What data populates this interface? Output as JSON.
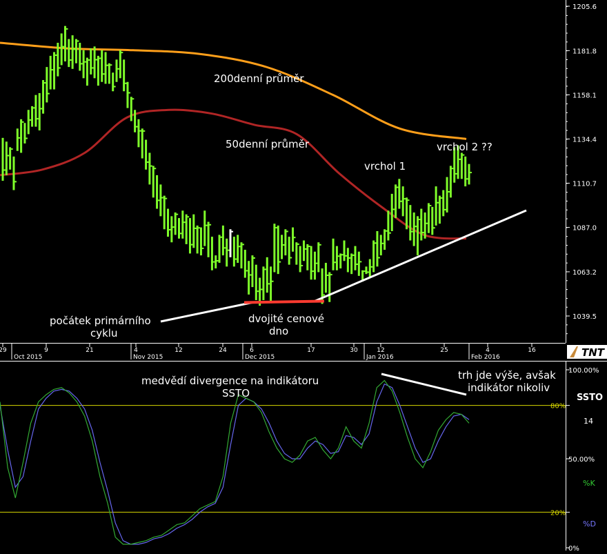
{
  "chart_data": [
    {
      "type": "ohlc",
      "price_axis": {
        "ticks": [
          "1205.6",
          "1181.8",
          "1158.1",
          "1134.4",
          "1110.7",
          "1087.0",
          "1063.2",
          "1039.5"
        ],
        "ylim": [
          1025,
          1212
        ]
      },
      "date_axis": {
        "ticks": [
          "29",
          "9",
          "21",
          "4",
          "12",
          "24",
          "6",
          "17",
          "30",
          "12",
          "25",
          "4",
          "16"
        ],
        "months": [
          "Oct 2015",
          "Nov 2015",
          "Dec 2015",
          "Jan 2016",
          "Feb 2016"
        ]
      },
      "logo": "TNT",
      "bars": [
        [
          1135,
          1112
        ],
        [
          1133,
          1115
        ],
        [
          1130,
          1118
        ],
        [
          1125,
          1107
        ],
        [
          1140,
          1128
        ],
        [
          1145,
          1127
        ],
        [
          1143,
          1132
        ],
        [
          1150,
          1137
        ],
        [
          1152,
          1141
        ],
        [
          1158,
          1141
        ],
        [
          1159,
          1139
        ],
        [
          1166,
          1148
        ],
        [
          1173,
          1154
        ],
        [
          1179,
          1161
        ],
        [
          1181,
          1161
        ],
        [
          1186,
          1168
        ],
        [
          1191,
          1174
        ],
        [
          1195,
          1176
        ],
        [
          1188,
          1173
        ],
        [
          1190,
          1172
        ],
        [
          1188,
          1175
        ],
        [
          1186,
          1171
        ],
        [
          1182,
          1167
        ],
        [
          1178,
          1163
        ],
        [
          1183,
          1169
        ],
        [
          1184,
          1167
        ],
        [
          1179,
          1163
        ],
        [
          1182,
          1165
        ],
        [
          1181,
          1164
        ],
        [
          1175,
          1164
        ],
        [
          1170,
          1160
        ],
        [
          1177,
          1165
        ],
        [
          1182,
          1167
        ],
        [
          1177,
          1160
        ],
        [
          1165,
          1151
        ],
        [
          1157,
          1144
        ],
        [
          1150,
          1138
        ],
        [
          1145,
          1130
        ],
        [
          1140,
          1124
        ],
        [
          1134,
          1118
        ],
        [
          1127,
          1110
        ],
        [
          1120,
          1103
        ],
        [
          1115,
          1097
        ],
        [
          1110,
          1093
        ],
        [
          1104,
          1086
        ],
        [
          1097,
          1082
        ],
        [
          1093,
          1079
        ],
        [
          1095,
          1083
        ],
        [
          1092,
          1081
        ],
        [
          1096,
          1081
        ],
        [
          1094,
          1078
        ],
        [
          1092,
          1073
        ],
        [
          1094,
          1076
        ],
        [
          1088,
          1073
        ],
        [
          1087,
          1072
        ],
        [
          1096,
          1077
        ],
        [
          1090,
          1071
        ],
        [
          1082,
          1064
        ],
        [
          1072,
          1065
        ],
        [
          1083,
          1068
        ],
        [
          1088,
          1072
        ],
        [
          1081,
          1066
        ],
        [
          1086,
          1071
        ],
        [
          1082,
          1066
        ],
        [
          1083,
          1068
        ],
        [
          1079,
          1065
        ],
        [
          1075,
          1060
        ],
        [
          1069,
          1051
        ],
        [
          1072,
          1055
        ],
        [
          1067,
          1048
        ],
        [
          1060,
          1045
        ],
        [
          1066,
          1048
        ],
        [
          1071,
          1052
        ],
        [
          1066,
          1047
        ],
        [
          1089,
          1063
        ],
        [
          1088,
          1062
        ],
        [
          1083,
          1070
        ],
        [
          1086,
          1072
        ],
        [
          1082,
          1067
        ],
        [
          1087,
          1074
        ],
        [
          1079,
          1067
        ],
        [
          1077,
          1063
        ],
        [
          1080,
          1069
        ],
        [
          1078,
          1064
        ],
        [
          1077,
          1059
        ],
        [
          1074,
          1059
        ],
        [
          1079,
          1063
        ],
        [
          1065,
          1046
        ],
        [
          1068,
          1052
        ],
        [
          1063,
          1047
        ],
        [
          1081,
          1064
        ],
        [
          1077,
          1064
        ],
        [
          1073,
          1065
        ],
        [
          1080,
          1069
        ],
        [
          1076,
          1063
        ],
        [
          1073,
          1062
        ],
        [
          1077,
          1064
        ],
        [
          1074,
          1061
        ],
        [
          1064,
          1058
        ],
        [
          1066,
          1062
        ],
        [
          1070,
          1060
        ],
        [
          1080,
          1063
        ],
        [
          1085,
          1066
        ],
        [
          1083,
          1072
        ],
        [
          1086,
          1075
        ],
        [
          1096,
          1080
        ],
        [
          1105,
          1085
        ],
        [
          1110,
          1092
        ],
        [
          1113,
          1097
        ],
        [
          1109,
          1093
        ],
        [
          1103,
          1086
        ],
        [
          1099,
          1080
        ],
        [
          1095,
          1077
        ],
        [
          1093,
          1072
        ],
        [
          1097,
          1080
        ],
        [
          1095,
          1081
        ],
        [
          1100,
          1084
        ],
        [
          1098,
          1083
        ],
        [
          1109,
          1088
        ],
        [
          1104,
          1089
        ],
        [
          1107,
          1093
        ],
        [
          1114,
          1095
        ],
        [
          1120,
          1103
        ],
        [
          1130,
          1111
        ],
        [
          1131,
          1113
        ],
        [
          1127,
          1113
        ],
        [
          1125,
          1109
        ],
        [
          1121,
          1110
        ]
      ],
      "ma200": [
        1186,
        1183,
        1182,
        1180,
        1173,
        1158,
        1140,
        1134.4
      ],
      "ma50": [
        1115,
        1118,
        1127,
        1146,
        1150,
        1148,
        1142,
        1137,
        1116,
        1098,
        1083,
        1081
      ],
      "annotations": {
        "ma200_label": "200denní průměr",
        "ma50_label": "50denní průměr",
        "peak1": "vrchol 1",
        "peak2": "vrchol 2 ??",
        "start_line1": "počátek primárního",
        "start_line2": "cyklu",
        "double_bottom_line1": "dvojité cenové",
        "double_bottom_line2": "dno"
      }
    },
    {
      "type": "line",
      "name": "SSTO",
      "ylim": [
        0,
        100
      ],
      "levels": [
        80,
        20
      ],
      "ticks": [
        "100.00%",
        "80%",
        "50.00%",
        "20%",
        "0%"
      ],
      "side_labels": {
        "title": "SSTO",
        "period": "14",
        "k": "%K",
        "d": "%D"
      },
      "annotations": {
        "divergence_line1": "medvědí divergence na indikátoru",
        "divergence_line2": "SSTO",
        "market_line1": "trh jde výše, avšak",
        "market_line2": "indikátor nikoliv"
      },
      "k": [
        82,
        45,
        28,
        48,
        70,
        82,
        86,
        89,
        90,
        87,
        82,
        74,
        60,
        40,
        25,
        6,
        2,
        2,
        3,
        4,
        6,
        7,
        10,
        13,
        14,
        18,
        22,
        24,
        26,
        40,
        70,
        86,
        84,
        82,
        76,
        65,
        56,
        50,
        48,
        52,
        60,
        62,
        55,
        50,
        56,
        68,
        60,
        56,
        70,
        90,
        94,
        88,
        76,
        62,
        50,
        45,
        54,
        66,
        72,
        76,
        75,
        70
      ],
      "d": [
        80,
        55,
        34,
        40,
        60,
        78,
        84,
        88,
        89,
        88,
        84,
        78,
        66,
        48,
        32,
        14,
        4,
        2,
        2,
        3,
        5,
        6,
        8,
        11,
        13,
        16,
        20,
        23,
        25,
        34,
        58,
        80,
        84,
        82,
        78,
        70,
        60,
        53,
        50,
        50,
        56,
        60,
        58,
        53,
        54,
        63,
        62,
        58,
        64,
        82,
        92,
        90,
        80,
        68,
        56,
        48,
        50,
        60,
        68,
        74,
        75,
        72
      ]
    }
  ],
  "colors": {
    "bar": "#7fff2a",
    "ma200": "#ff9f1a",
    "ma50": "#b02525",
    "trend": "#ffffff",
    "bottom": "#ff3b30",
    "k": "#33aa33",
    "d": "#6666ee",
    "level": "#d8d800",
    "text": "#ffffff"
  }
}
